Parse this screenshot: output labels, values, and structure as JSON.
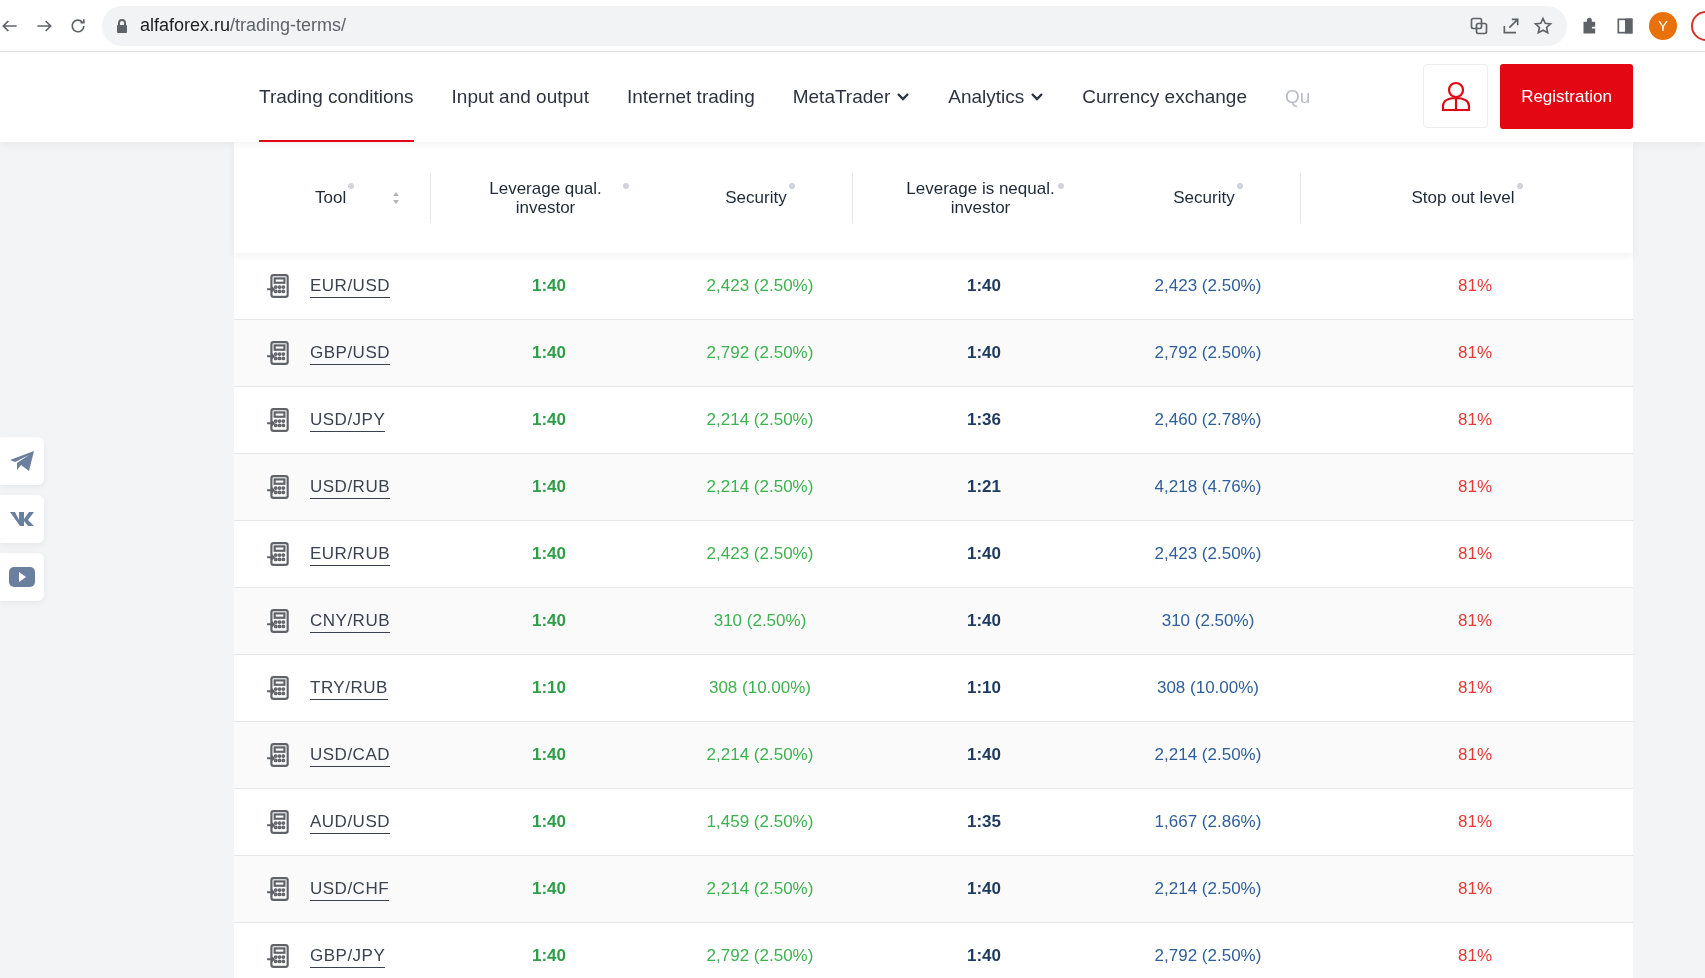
{
  "browser": {
    "url_host": "alfaforex.ru",
    "url_path": "/trading-terms/",
    "profile_initial": "Y"
  },
  "nav": {
    "items": [
      {
        "label": "Trading conditions",
        "selected": true,
        "dropdown": false
      },
      {
        "label": "Input and output",
        "selected": false,
        "dropdown": false
      },
      {
        "label": "Internet trading",
        "selected": false,
        "dropdown": false
      },
      {
        "label": "MetaTrader",
        "selected": false,
        "dropdown": true
      },
      {
        "label": "Analytics",
        "selected": false,
        "dropdown": true
      },
      {
        "label": "Currency exchange",
        "selected": false,
        "dropdown": false
      },
      {
        "label": "Qu",
        "selected": false,
        "dropdown": false
      }
    ],
    "register_button": "Registration"
  },
  "table": {
    "columns": [
      "Tool",
      "Leverage qual. investor",
      "Security",
      "Leverage is nequal. investor",
      "Security",
      "Stop out level"
    ],
    "rows": [
      {
        "tool": "EUR/USD",
        "leverage_qual": "1:40",
        "security_qual": "2,423 (2.50%)",
        "leverage_nequal": "1:40",
        "security_nequal": "2,423 (2.50%)",
        "stop_out": "81%"
      },
      {
        "tool": "GBP/USD",
        "leverage_qual": "1:40",
        "security_qual": "2,792 (2.50%)",
        "leverage_nequal": "1:40",
        "security_nequal": "2,792 (2.50%)",
        "stop_out": "81%"
      },
      {
        "tool": "USD/JPY",
        "leverage_qual": "1:40",
        "security_qual": "2,214 (2.50%)",
        "leverage_nequal": "1:36",
        "security_nequal": "2,460 (2.78%)",
        "stop_out": "81%"
      },
      {
        "tool": "USD/RUB",
        "leverage_qual": "1:40",
        "security_qual": "2,214 (2.50%)",
        "leverage_nequal": "1:21",
        "security_nequal": "4,218 (4.76%)",
        "stop_out": "81%"
      },
      {
        "tool": "EUR/RUB",
        "leverage_qual": "1:40",
        "security_qual": "2,423 (2.50%)",
        "leverage_nequal": "1:40",
        "security_nequal": "2,423 (2.50%)",
        "stop_out": "81%"
      },
      {
        "tool": "CNY/RUB",
        "leverage_qual": "1:40",
        "security_qual": "310 (2.50%)",
        "leverage_nequal": "1:40",
        "security_nequal": "310 (2.50%)",
        "stop_out": "81%"
      },
      {
        "tool": "TRY/RUB",
        "leverage_qual": "1:10",
        "security_qual": "308 (10.00%)",
        "leverage_nequal": "1:10",
        "security_nequal": "308 (10.00%)",
        "stop_out": "81%"
      },
      {
        "tool": "USD/CAD",
        "leverage_qual": "1:40",
        "security_qual": "2,214 (2.50%)",
        "leverage_nequal": "1:40",
        "security_nequal": "2,214 (2.50%)",
        "stop_out": "81%"
      },
      {
        "tool": "AUD/USD",
        "leverage_qual": "1:40",
        "security_qual": "1,459 (2.50%)",
        "leverage_nequal": "1:35",
        "security_nequal": "1,667 (2.86%)",
        "stop_out": "81%"
      },
      {
        "tool": "USD/CHF",
        "leverage_qual": "1:40",
        "security_qual": "2,214 (2.50%)",
        "leverage_nequal": "1:40",
        "security_nequal": "2,214 (2.50%)",
        "stop_out": "81%"
      },
      {
        "tool": "GBP/JPY",
        "leverage_qual": "1:40",
        "security_qual": "2,792 (2.50%)",
        "leverage_nequal": "1:40",
        "security_nequal": "2,792 (2.50%)",
        "stop_out": "81%"
      }
    ]
  }
}
